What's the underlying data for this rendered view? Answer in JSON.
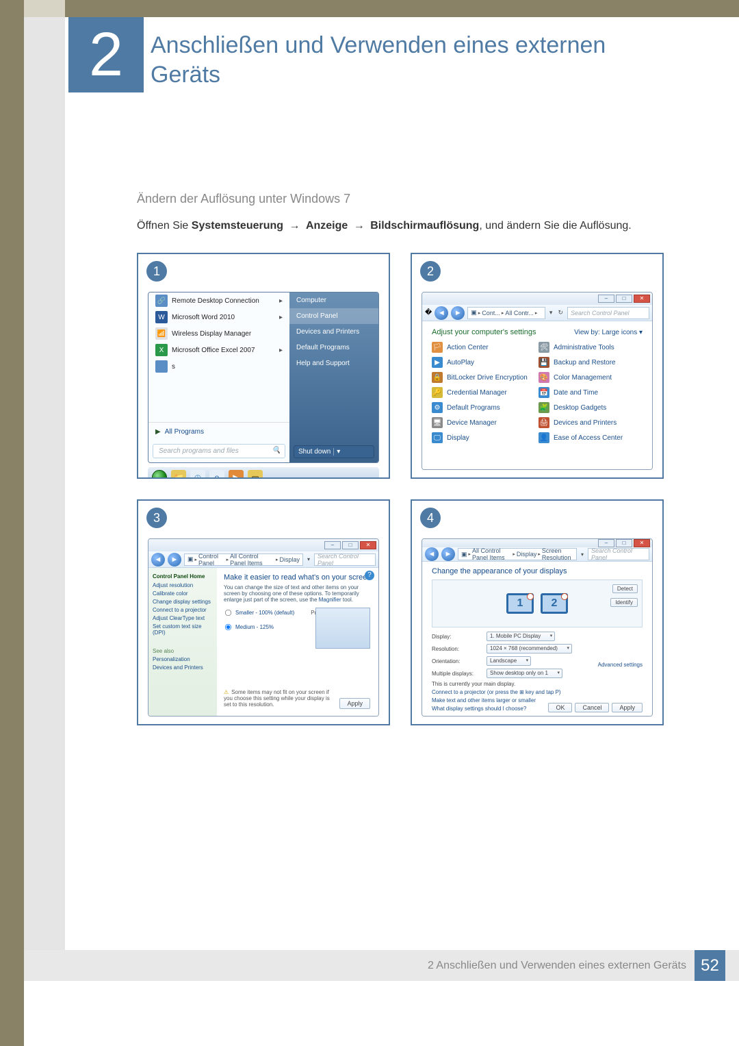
{
  "chapter": {
    "number": "2",
    "title": "Anschließen und Verwenden eines externen Geräts"
  },
  "section_heading": "Ändern der Auflösung unter Windows 7",
  "body_text": {
    "prefix": "Öffnen Sie ",
    "b1": "Systemsteuerung",
    "arrow": "→",
    "b2": "Anzeige",
    "b3": "Bildschirmauflösung",
    "suffix": ", und ändern Sie die Auflösung."
  },
  "steps": {
    "s1": "1",
    "s2": "2",
    "s3": "3",
    "s4": "4"
  },
  "s1": {
    "items": [
      {
        "label": "Remote Desktop Connection",
        "arrow": true,
        "icon": "🔗",
        "bg": "#5a8ec5"
      },
      {
        "label": "Microsoft Word 2010",
        "arrow": true,
        "icon": "W",
        "bg": "#2a5a9a"
      },
      {
        "label": "Wireless Display Manager",
        "arrow": false,
        "icon": "📶",
        "bg": "#e0e0e0"
      },
      {
        "label": "Microsoft Office Excel 2007",
        "arrow": true,
        "icon": "X",
        "bg": "#2a9a4a"
      },
      {
        "label": "s",
        "arrow": false,
        "icon": "",
        "bg": "#5a8ec5"
      }
    ],
    "all_programs": "All Programs",
    "search_placeholder": "Search programs and files",
    "right": [
      "Computer",
      "Control Panel",
      "Devices and Printers",
      "Default Programs",
      "Help and Support"
    ],
    "shutdown": "Shut down"
  },
  "s2": {
    "breadcrumb": [
      "Cont...",
      "All Contr..."
    ],
    "search_placeholder": "Search Control Panel",
    "adjust": "Adjust your computer's settings",
    "viewby": "View by:   Large icons ▾",
    "items_left": [
      "Action Center",
      "AutoPlay",
      "BitLocker Drive Encryption",
      "Credential Manager",
      "Default Programs",
      "Device Manager",
      "Display"
    ],
    "items_right": [
      "Administrative Tools",
      "Backup and Restore",
      "Color Management",
      "Date and Time",
      "Desktop Gadgets",
      "Devices and Printers",
      "Ease of Access Center"
    ],
    "icon_colors": [
      "#e09040",
      "#3a8ad0",
      "#c07a30",
      "#d6bb3a",
      "#3a8ad0",
      "#8a8a8a",
      "#3a8ad0",
      "#8a9aa5",
      "#a05030",
      "#d07ab0",
      "#3a8ad0",
      "#6a9a4a",
      "#c05030",
      "#3a8ad0"
    ]
  },
  "s3": {
    "breadcrumb": [
      "Control Panel",
      "All Control Panel Items",
      "Display"
    ],
    "search_placeholder": "Search Control Panel",
    "sidebar_head": "Control Panel Home",
    "sidebar_links": [
      "Adjust resolution",
      "Calibrate color",
      "Change display settings",
      "Connect to a projector",
      "Adjust ClearType text",
      "Set custom text size (DPI)"
    ],
    "see_also": "See also",
    "see_links": [
      "Personalization",
      "Devices and Printers"
    ],
    "h1": "Make it easier to read what's on your screen",
    "desc": "You can change the size of text and other items on your screen by choosing one of these options. To temporarily enlarge just part of the screen, use the ",
    "desc_link": "Magnifier",
    "desc_tail": " tool.",
    "option1": "Smaller - 100% (default)",
    "option1_tail": "Preview",
    "option2": "Medium - 125%",
    "warn": "Some items may not fit on your screen if you choose this setting while your display is set to this resolution.",
    "apply": "Apply"
  },
  "s4": {
    "breadcrumb": [
      "All Control Panel Items",
      "Display",
      "Screen Resolution"
    ],
    "search_placeholder": "Search Control Panel",
    "h1": "Change the appearance of your displays",
    "detect": "Detect",
    "identify": "Identify",
    "mon1": "1",
    "mon2": "2",
    "rows": {
      "display_lbl": "Display:",
      "display_val": "1. Mobile PC Display",
      "res_lbl": "Resolution:",
      "res_val": "1024 × 768   (recommended)",
      "orient_lbl": "Orientation:",
      "orient_val": "Landscape",
      "multi_lbl": "Multiple displays:",
      "multi_val": "Show desktop only on 1"
    },
    "note": "This is currently your main display.",
    "links": [
      "Connect to a projector (or press the ⊞ key and tap P)",
      "Make text and other items larger or smaller",
      "What display settings should I choose?"
    ],
    "adv": "Advanced settings",
    "buttons": [
      "OK",
      "Cancel",
      "Apply"
    ]
  },
  "footer": {
    "label": "2 Anschließen und Verwenden eines externen Geräts",
    "page": "52"
  }
}
